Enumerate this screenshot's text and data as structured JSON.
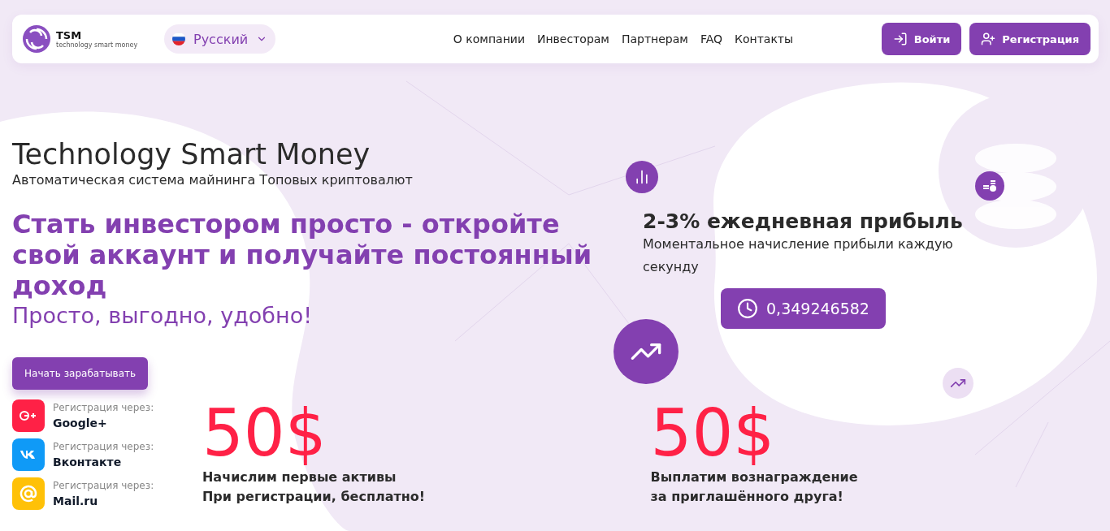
{
  "header": {
    "logo": {
      "name": "TSM",
      "tagline": "technology smart money"
    },
    "language": {
      "label": "Русский"
    },
    "nav": [
      {
        "label": "О компании"
      },
      {
        "label": "Инвесторам"
      },
      {
        "label": "Партнерам"
      },
      {
        "label": "FAQ"
      },
      {
        "label": "Контакты"
      }
    ],
    "buttons": [
      {
        "kind": "login",
        "label": "Войти"
      },
      {
        "kind": "register",
        "label": "Регистрация"
      }
    ]
  },
  "hero": {
    "title": "Technology Smart Money",
    "subtitle": "Автоматическая система майнинга Топовых криптовалют",
    "headline": "Стать инвестором просто - откройте свой аккаунт и получайте постоянный доход",
    "slogan": "Просто, выгодно, удобно!",
    "cta": "Начать зарабатывать"
  },
  "profit": {
    "title": "2-3% ежедневная прибыль",
    "text": "Моментальное начисление прибыли каждую секунду",
    "counter": "0,349246582"
  },
  "socials": [
    {
      "kind": "google",
      "color": "#ff2146",
      "caption": "Регистрация через:",
      "name": "Google+"
    },
    {
      "kind": "vk",
      "color": "#0f9af7",
      "caption": "Регистрация через:",
      "name": "Вконтакте"
    },
    {
      "kind": "mail",
      "color": "#ffc107",
      "caption": "Регистрация через:",
      "name": "Mail.ru"
    }
  ],
  "bonuses": [
    {
      "amount": "50$",
      "lines": [
        "Начислим первые активы",
        "При регистрации, бесплатно!"
      ]
    },
    {
      "amount": "50$",
      "lines": [
        "Выплатим вознаграждение",
        "за приглашённого друга!"
      ]
    }
  ]
}
